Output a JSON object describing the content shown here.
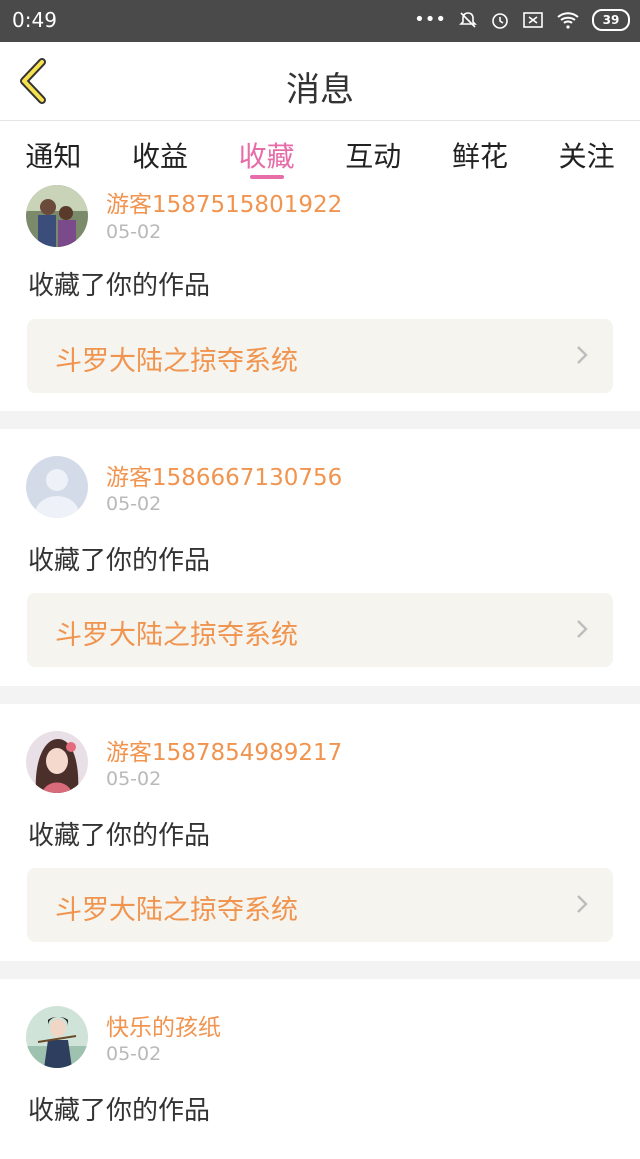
{
  "status_bar": {
    "time": "0:49",
    "icons": [
      "more-dots-icon",
      "bell-off-icon",
      "alarm-icon",
      "sim-x-icon",
      "wifi-icon"
    ],
    "battery": "39"
  },
  "header": {
    "title": "消息",
    "back_icon": "back-arrow-icon"
  },
  "tabs": [
    {
      "label": "通知"
    },
    {
      "label": "收益"
    },
    {
      "label": "收藏",
      "active": true
    },
    {
      "label": "互动"
    },
    {
      "label": "鲜花"
    },
    {
      "label": "关注"
    }
  ],
  "colors": {
    "accent": "#e76da9",
    "name": "#f0944f",
    "muted": "#b9b9b9",
    "work_bg": "#f5f4ee"
  },
  "messages": [
    {
      "user": "游客1587515801922",
      "date": "05-02",
      "action": "收藏了你的作品",
      "work": "斗罗大陆之掠夺系统"
    },
    {
      "user": "游客1586667130756",
      "date": "05-02",
      "action": "收藏了你的作品",
      "work": "斗罗大陆之掠夺系统"
    },
    {
      "user": "游客1587854989217",
      "date": "05-02",
      "action": "收藏了你的作品",
      "work": "斗罗大陆之掠夺系统"
    },
    {
      "user": "快乐的孩纸",
      "date": "05-02",
      "action": "收藏了你的作品"
    }
  ]
}
